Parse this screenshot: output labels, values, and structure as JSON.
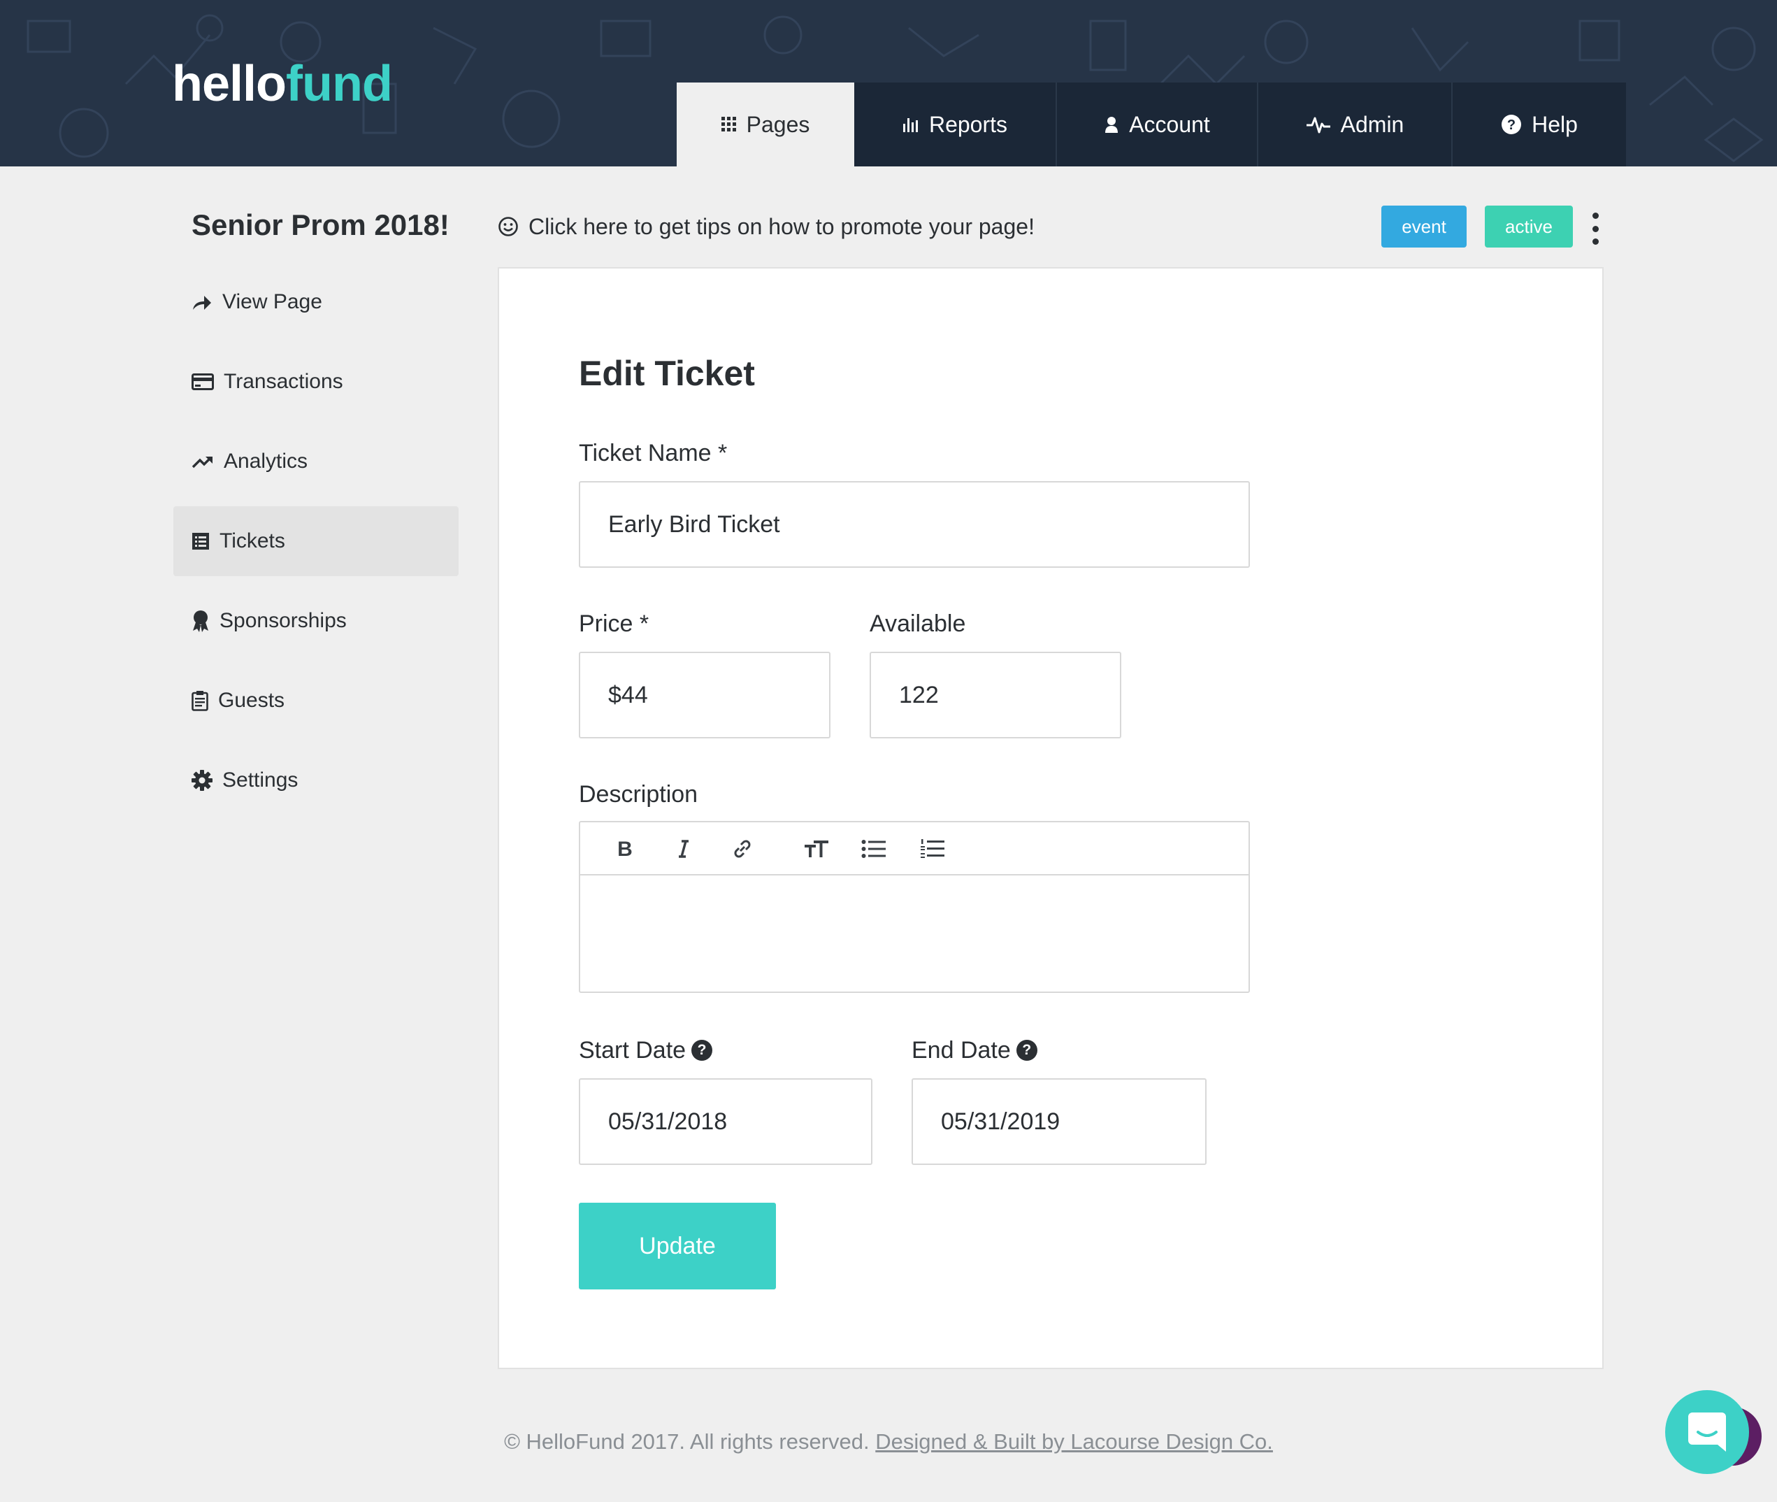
{
  "brand": {
    "part1": "hello",
    "part2": "fund",
    "accent_color": "#3dd1c7",
    "header_color": "#263447"
  },
  "nav": {
    "tabs": [
      {
        "label": "Pages",
        "icon": "grid-icon",
        "active": true
      },
      {
        "label": "Reports",
        "icon": "bar-chart-icon",
        "active": false
      },
      {
        "label": "Account",
        "icon": "user-icon",
        "active": false
      },
      {
        "label": "Admin",
        "icon": "pulse-icon",
        "active": false
      },
      {
        "label": "Help",
        "icon": "question-circle-icon",
        "active": false
      }
    ]
  },
  "page": {
    "title": "Senior Prom 2018!",
    "tips": "Click here to get tips on how to promote your page!",
    "badges": {
      "type": "event",
      "status": "active"
    }
  },
  "sidebar": {
    "items": [
      {
        "label": "View Page",
        "icon": "share-arrow-icon"
      },
      {
        "label": "Transactions",
        "icon": "credit-card-icon"
      },
      {
        "label": "Analytics",
        "icon": "trending-up-icon"
      },
      {
        "label": "Tickets",
        "icon": "list-icon",
        "active": true
      },
      {
        "label": "Sponsorships",
        "icon": "award-ribbon-icon"
      },
      {
        "label": "Guests",
        "icon": "clipboard-icon"
      },
      {
        "label": "Settings",
        "icon": "gear-icon"
      }
    ]
  },
  "form": {
    "title": "Edit Ticket",
    "ticket_name": {
      "label": "Ticket Name *",
      "value": "Early Bird Ticket"
    },
    "price": {
      "label": "Price *",
      "value": "$44"
    },
    "available": {
      "label": "Available",
      "value": "122"
    },
    "description": {
      "label": "Description",
      "value": ""
    },
    "start_date": {
      "label": "Start Date",
      "value": "05/31/2018"
    },
    "end_date": {
      "label": "End Date",
      "value": "05/31/2019"
    },
    "help_glyph": "?",
    "submit_label": "Update",
    "toolbar": [
      "bold-icon",
      "italic-icon",
      "link-icon",
      "heading-icon",
      "bullet-list-icon",
      "numbered-list-icon"
    ]
  },
  "footer": {
    "copyright": "© HelloFund 2017. All rights reserved.",
    "credit": "Designed & Built by Lacourse Design Co."
  }
}
